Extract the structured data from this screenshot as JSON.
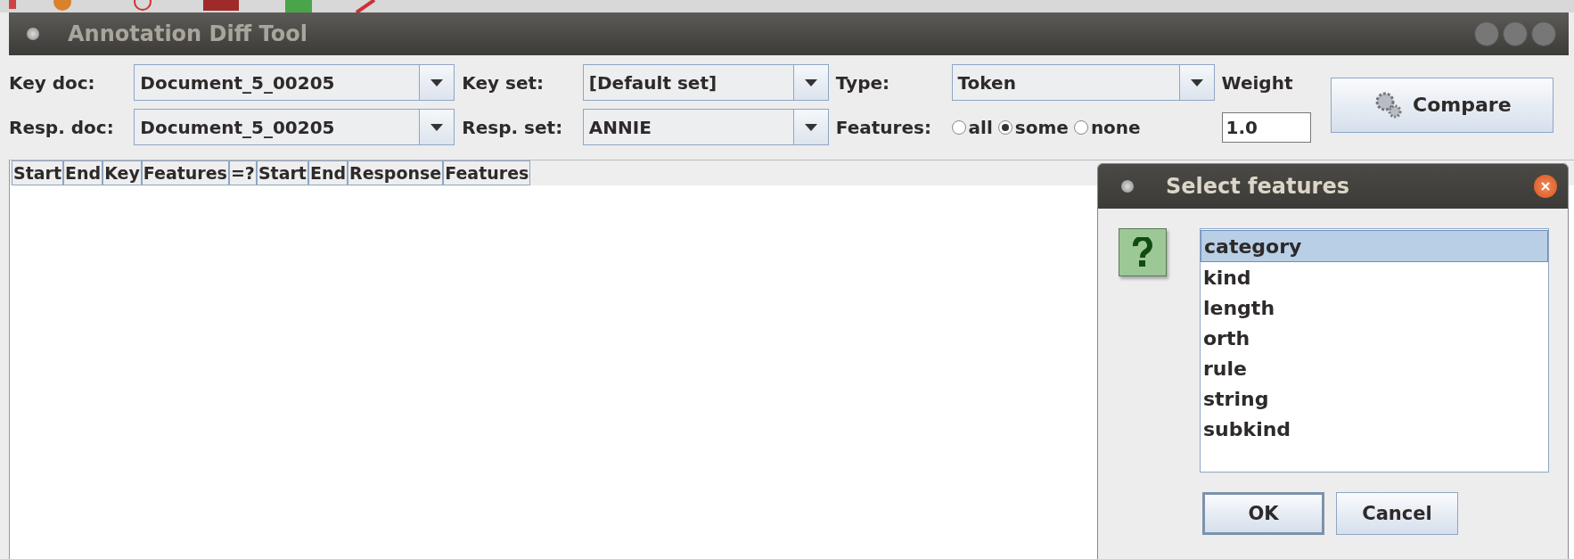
{
  "window": {
    "title": "Annotation Diff Tool"
  },
  "form": {
    "key_doc": {
      "label": "Key doc:",
      "value": "Document_5_00205"
    },
    "key_set": {
      "label": "Key set:",
      "value": "[Default set]"
    },
    "type": {
      "label": "Type:",
      "value": "Token"
    },
    "weight": {
      "label": "Weight",
      "value": "1.0"
    },
    "resp_doc": {
      "label": "Resp. doc:",
      "value": "Document_5_00205"
    },
    "resp_set": {
      "label": "Resp. set:",
      "value": "ANNIE"
    },
    "features": {
      "label": "Features:",
      "options": [
        {
          "label": "all",
          "selected": false
        },
        {
          "label": "some",
          "selected": true
        },
        {
          "label": "none",
          "selected": false
        }
      ]
    },
    "compare_button": "Compare"
  },
  "table": {
    "columns": [
      "Start",
      "End",
      "Key",
      "Features",
      "=?",
      "Start",
      "End",
      "Response",
      "Features"
    ]
  },
  "dialog": {
    "title": "Select features",
    "items": [
      {
        "label": "category",
        "selected": true
      },
      {
        "label": "kind",
        "selected": false
      },
      {
        "label": "length",
        "selected": false
      },
      {
        "label": "orth",
        "selected": false
      },
      {
        "label": "rule",
        "selected": false
      },
      {
        "label": "string",
        "selected": false
      },
      {
        "label": "subkind",
        "selected": false
      }
    ],
    "buttons": [
      "OK",
      "Cancel"
    ]
  }
}
